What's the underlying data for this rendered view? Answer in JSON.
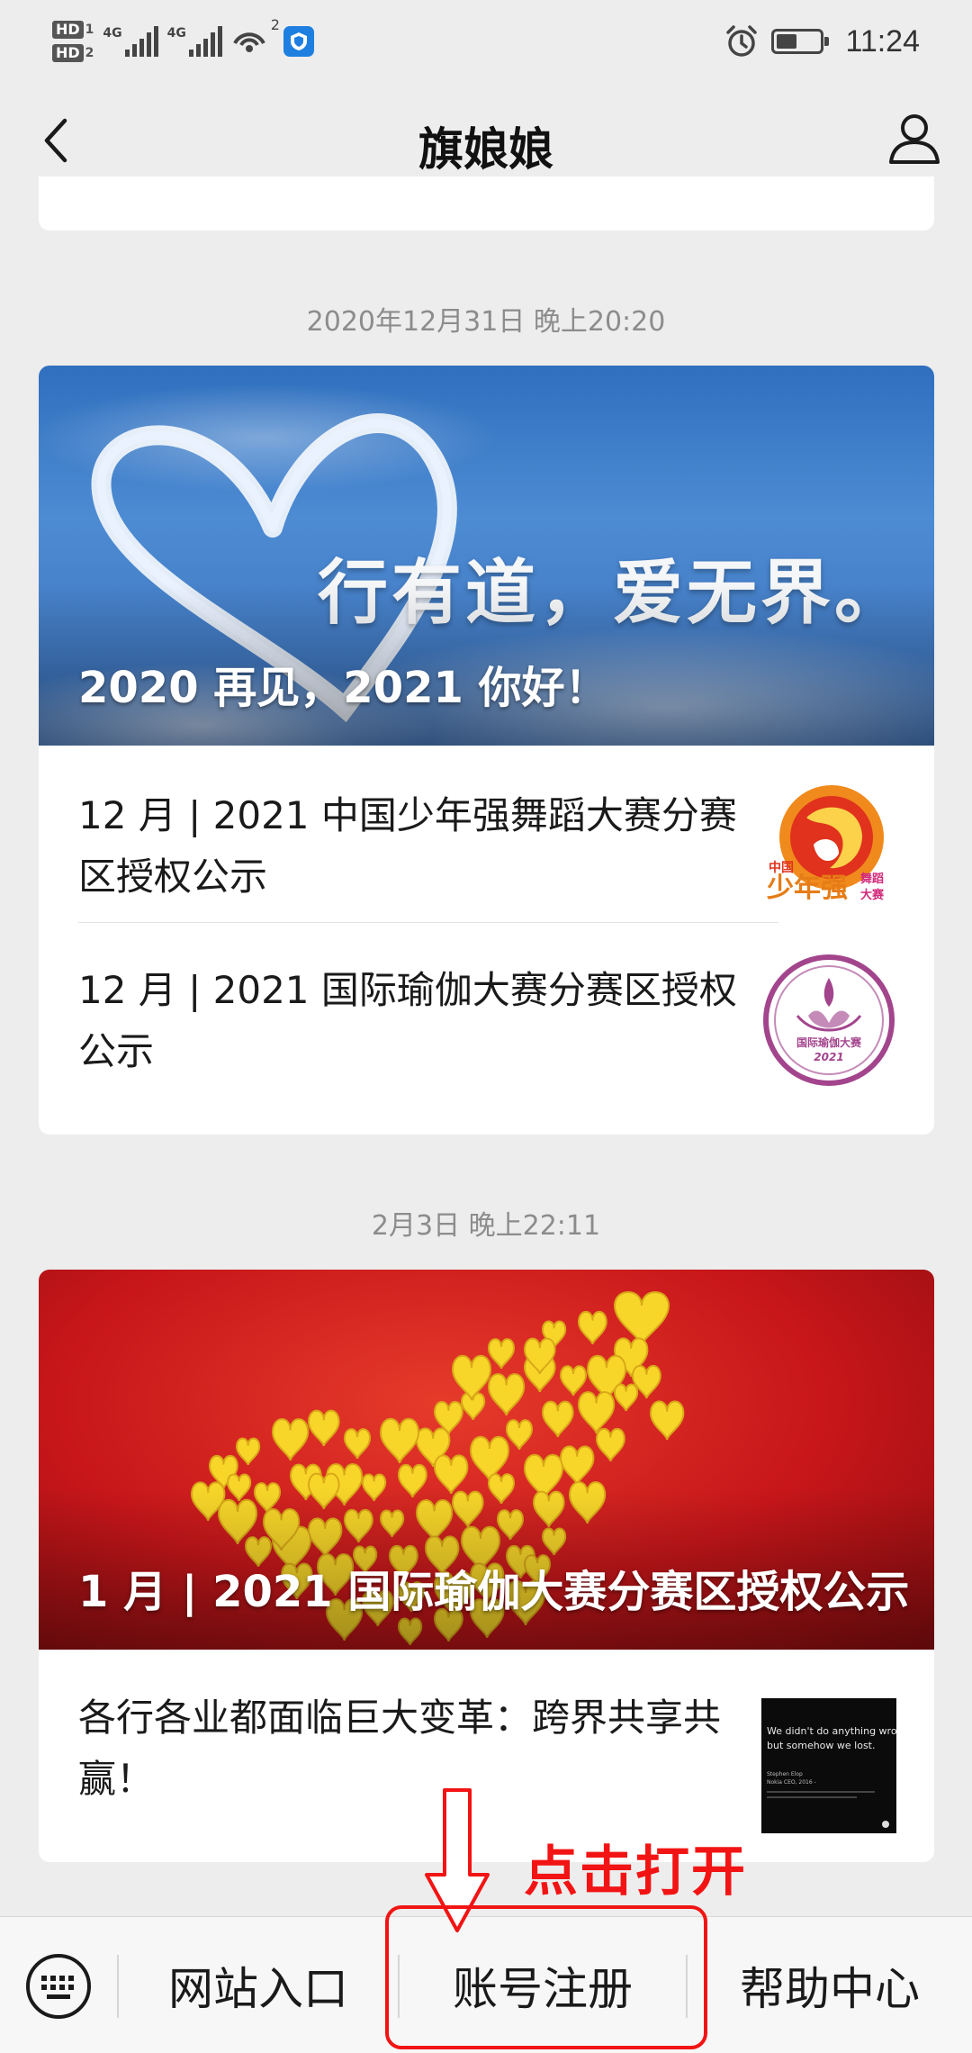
{
  "status_bar": {
    "hd1": "HD",
    "hd1_sub": "1",
    "hd2": "HD",
    "hd2_sub": "2",
    "sim1_label": "4G",
    "sim2_label": "4G",
    "hotspot_count": "2",
    "time": "11:24"
  },
  "nav": {
    "title": "旗娘娘"
  },
  "feed": [
    {
      "timestamp": "2020年12月31日 晚上20:20",
      "banner_title": "2020 再见，2021 你好！",
      "banner_slogan": "行有道，爱无界。",
      "articles": [
        {
          "title": "12 月 | 2021 中国少年强舞蹈大赛分赛区授权公示",
          "thumb": "youth-dance-logo"
        },
        {
          "title": "12 月 | 2021 国际瑜伽大赛分赛区授权公示",
          "thumb": "yoga-contest-logo"
        }
      ]
    },
    {
      "timestamp": "2月3日 晚上22:11",
      "banner_title": "1 月 | 2021 国际瑜伽大赛分赛区授权公示",
      "articles": [
        {
          "title": "各行各业都面临巨大变革：跨界共享共赢！",
          "thumb": "quote-slide"
        }
      ]
    }
  ],
  "thumbs": {
    "youth_dance": {
      "line1": "中国",
      "line2": "少年强",
      "line3": "舞蹈",
      "line4": "大赛"
    },
    "yoga": {
      "line1": "国际瑜伽大赛",
      "line2": "2021"
    },
    "quote": {
      "line1": "We didn't do anything wro",
      "line2": "but somehow we lost.",
      "author": "Stephen Elop",
      "role": "Nokia CEO, 2016 -"
    }
  },
  "bottom_menu": {
    "items": [
      {
        "label": "网站入口"
      },
      {
        "label": "账号注册"
      },
      {
        "label": "帮助中心"
      }
    ]
  },
  "annotation": {
    "text": "点击打开",
    "color": "#f21414"
  },
  "colors": {
    "background": "#ededed",
    "card": "#ffffff",
    "timestamp": "#8c8c8c"
  }
}
